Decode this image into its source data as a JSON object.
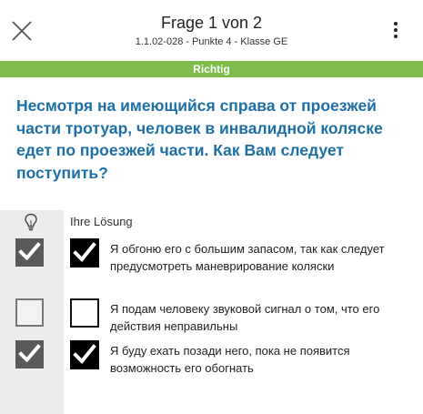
{
  "header": {
    "title": "Frage 1 von 2",
    "subtitle": "1.1.02-028 - Punkte 4 - Klasse GE",
    "close_icon": "close-icon",
    "menu_icon": "more-vertical-icon"
  },
  "status": {
    "label": "Richtig",
    "color": "#7dbd4c"
  },
  "question": {
    "text": "Несмотря на имеющийся справа от проезжей части тротуар, человек в инвалидной коляске едет по проезжей части. Как Вам следует поступить?",
    "color": "#1d6fa5"
  },
  "answers_header": {
    "hint_icon": "lightbulb-icon",
    "label": "Ihre Lösung"
  },
  "answers": [
    {
      "text": "Я обгоню его с большим запасом, так как следует предусмотреть маневрирование коляски",
      "solution_checked": true,
      "user_checked": true
    },
    {
      "text": "Я подам человеку звуковой сигнал о том, что его действия неправильны",
      "solution_checked": false,
      "user_checked": false
    },
    {
      "text": "Я буду ехать позади него, пока не появится возможность его обогнать",
      "solution_checked": true,
      "user_checked": true
    }
  ]
}
